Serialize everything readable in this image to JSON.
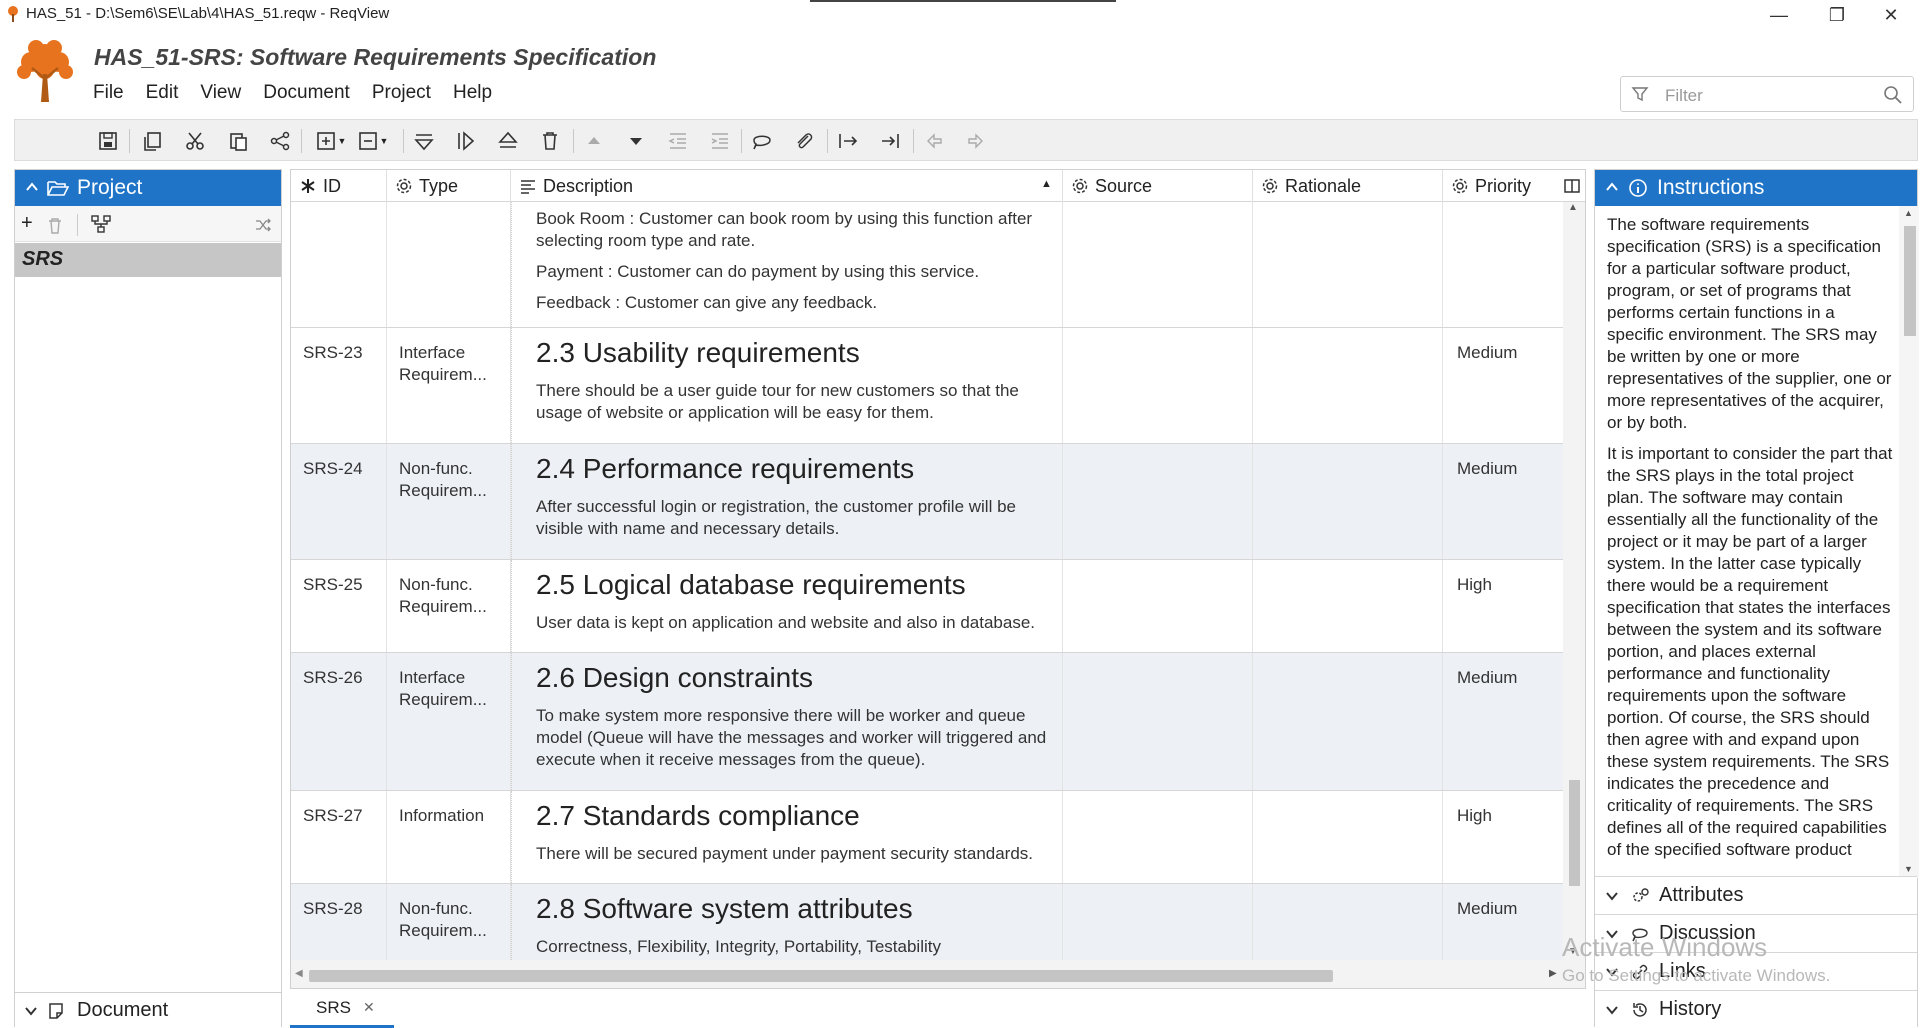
{
  "window": {
    "title": "HAS_51 - D:\\Sem6\\SE\\Lab\\4\\HAS_51.reqw - ReqView",
    "minimize": "—",
    "restore": "❐",
    "close": "✕"
  },
  "header": {
    "doc_title": "HAS_51-SRS: Software Requirements Specification",
    "menu": [
      "File",
      "Edit",
      "View",
      "Document",
      "Project",
      "Help"
    ],
    "filter_placeholder": "Filter"
  },
  "left_panel": {
    "title": "Project",
    "document_item": "SRS",
    "footer_label": "Document"
  },
  "grid": {
    "columns": [
      "ID",
      "Type",
      "Description",
      "Source",
      "Rationale",
      "Priority"
    ],
    "rows": [
      {
        "id": "",
        "type": "",
        "heading": "",
        "paragraphs": [
          "Book Room : Customer can book room by using this function after selecting room type and rate.",
          "Payment : Customer can do payment by using this service.",
          "Feedback : Customer can give any feedback."
        ],
        "priority": ""
      },
      {
        "id": "SRS-23",
        "type": "Interface Requirem...",
        "heading": "2.3 Usability requirements",
        "paragraphs": [
          "There should be a user guide tour for new customers so that the usage of website or application will be easy for them."
        ],
        "priority": "Medium"
      },
      {
        "id": "SRS-24",
        "type": "Non-func. Requirem...",
        "heading": "2.4 Performance requirements",
        "paragraphs": [
          "After successful login or registration, the customer profile will be visible with name and necessary details."
        ],
        "priority": "Medium"
      },
      {
        "id": "SRS-25",
        "type": "Non-func. Requirem...",
        "heading": "2.5 Logical database requirements",
        "paragraphs": [
          "User data is kept on application and website and also in database."
        ],
        "priority": "High"
      },
      {
        "id": "SRS-26",
        "type": "Interface Requirem...",
        "heading": "2.6 Design constraints",
        "paragraphs": [
          "To make system more responsive there will be worker and queue model (Queue will have the messages and worker will triggered and execute when it receive messages from the queue)."
        ],
        "priority": "Medium"
      },
      {
        "id": "SRS-27",
        "type": "Information",
        "heading": "2.7 Standards compliance",
        "paragraphs": [
          "There will be secured payment under payment security standards."
        ],
        "priority": "High"
      },
      {
        "id": "SRS-28",
        "type": "Non-func. Requirem...",
        "heading": "2.8 Software system attributes",
        "paragraphs": [
          "Correctness, Flexibility, Integrity, Portability, Testability"
        ],
        "priority": "Medium"
      }
    ]
  },
  "tabs": [
    {
      "label": "SRS",
      "close": "✕"
    }
  ],
  "right_panel": {
    "title": "Instructions",
    "paragraphs": [
      "The software requirements specification (SRS) is a specification for a particular software product, program, or set of programs that performs certain functions in a specific environment. The SRS may be written by one or more representatives of the supplier, one or more representatives of the acquirer, or by both.",
      "It is important to consider the part that the SRS plays in the total project plan. The software may contain essentially all the functionality of the project or it may be part of a larger system. In the latter case typically there would be a requirement specification that states the interfaces between the system and its software portion, and places external performance and functionality requirements upon the software portion. Of course, the SRS should then agree with and expand upon these system requirements. The SRS indicates the precedence and criticality of requirements. The SRS defines all of the required capabilities of the specified software product"
    ],
    "sections": [
      "Attributes",
      "Discussion",
      "Links",
      "History"
    ]
  },
  "watermark": {
    "line1": "Activate Windows",
    "line2": "Go to Settings to activate Windows."
  },
  "colors": {
    "accent": "#1f74c8",
    "row_alt": "#edf1f6",
    "logo": "#e8731f"
  }
}
